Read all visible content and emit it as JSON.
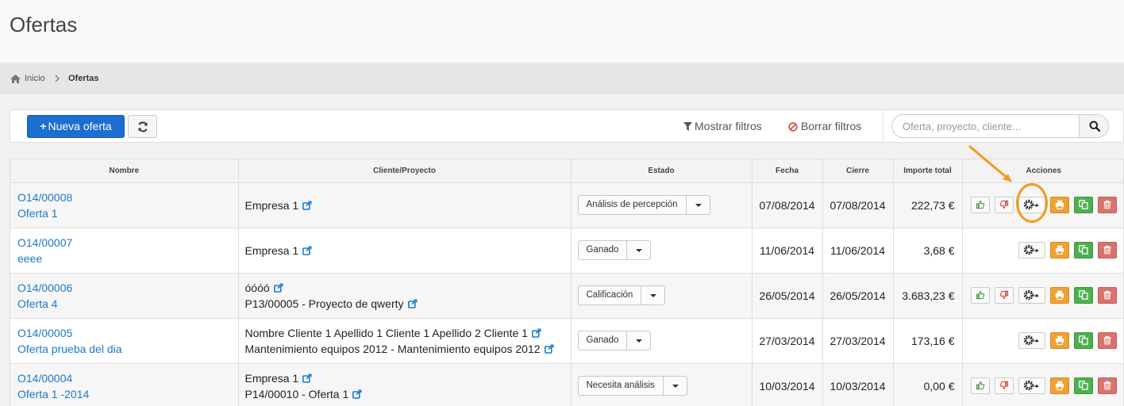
{
  "page": {
    "title": "Ofertas"
  },
  "breadcrumb": {
    "home_label": "Inicio",
    "current": "Ofertas"
  },
  "toolbar": {
    "new_label": "Nueva oferta",
    "show_filters": "Mostrar filtros",
    "clear_filters": "Borrar filtros",
    "search_placeholder": "Oferta, proyecto, cliente..."
  },
  "table": {
    "headers": [
      "Nombre",
      "Cliente/Proyecto",
      "Estado",
      "Fecha",
      "Cierre",
      "Importe total",
      "Acciones"
    ],
    "rows": [
      {
        "code": "O14/00008",
        "name": "Oferta 1",
        "cliente": "Empresa 1",
        "proyecto": "",
        "estado": "Análisis de percepción",
        "fecha": "07/08/2014",
        "cierre": "07/08/2014",
        "importe": "222,73 €",
        "thumbs": true
      },
      {
        "code": "O14/00007",
        "name": "eeee",
        "cliente": "Empresa 1",
        "proyecto": "",
        "estado": "Ganado",
        "fecha": "11/06/2014",
        "cierre": "11/06/2014",
        "importe": "3,68 €",
        "thumbs": false
      },
      {
        "code": "O14/00006",
        "name": "Oferta 4",
        "cliente": "óóóó",
        "proyecto": "P13/00005 - Proyecto de qwerty",
        "estado": "Calificación",
        "fecha": "26/05/2014",
        "cierre": "26/05/2014",
        "importe": "3.683,23 €",
        "thumbs": true
      },
      {
        "code": "O14/00005",
        "name": "Oferta prueba del dia",
        "cliente": "Nombre Cliente 1 Apellido 1 Cliente 1 Apellido 2 Cliente 1",
        "proyecto": "Mantenimiento equipos 2012 - Mantenimiento equipos 2012",
        "estado": "Ganado",
        "fecha": "27/03/2014",
        "cierre": "27/03/2014",
        "importe": "173,16 €",
        "thumbs": false
      },
      {
        "code": "O14/00004",
        "name": "Oferta 1 -2014",
        "cliente": "Empresa 1",
        "proyecto": "P14/00010 - Oferta 1",
        "estado": "Necesita análisis",
        "fecha": "10/03/2014",
        "cierre": "10/03/2014",
        "importe": "0,00 €",
        "thumbs": true
      }
    ]
  },
  "icons": {
    "home": "home-icon",
    "chevron": "chevron-right-icon",
    "refresh": "refresh-icon",
    "filter": "filter-icon",
    "ban": "ban-icon",
    "search": "search-icon",
    "external": "external-link-icon",
    "thumbs_up": "thumbs-up-icon",
    "thumbs_down": "thumbs-down-icon",
    "gear": "gear-icon",
    "print": "print-icon",
    "copy": "copy-icon",
    "trash": "trash-icon"
  },
  "colors": {
    "primary": "#1c6fd1",
    "link": "#1b79c9",
    "callout": "#f29b1d",
    "print": "#f0a134",
    "copy": "#4db04e",
    "delete": "#d9726d"
  }
}
